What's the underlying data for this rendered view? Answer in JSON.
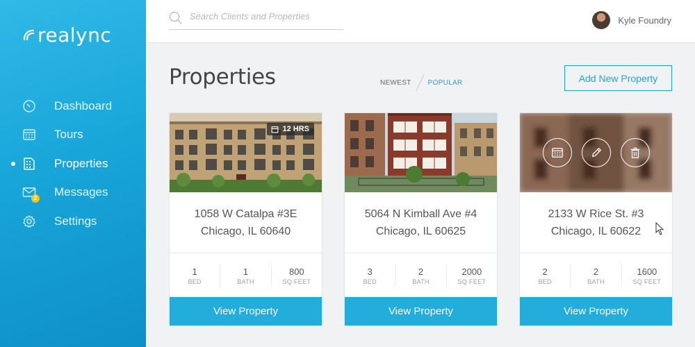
{
  "brand": {
    "name": "realync"
  },
  "sidebar": {
    "items": [
      {
        "label": "Dashboard",
        "icon": "compass-icon",
        "active": false
      },
      {
        "label": "Tours",
        "icon": "calendar-icon",
        "active": false
      },
      {
        "label": "Properties",
        "icon": "properties-grid-icon",
        "active": true
      },
      {
        "label": "Messages",
        "icon": "mail-icon",
        "active": false,
        "badge": "2"
      },
      {
        "label": "Settings",
        "icon": "gear-icon",
        "active": false
      }
    ]
  },
  "header": {
    "search": {
      "placeholder": "Search Clients and Properties",
      "value": ""
    },
    "user": {
      "name": "Kyle Foundry"
    }
  },
  "page": {
    "title": "Properties",
    "sort": {
      "newest": "NEWEST",
      "popular": "POPULAR",
      "selected": "POPULAR"
    },
    "add_button": "Add New Property"
  },
  "properties": [
    {
      "address_line1": "1058 W Catalpa #3E",
      "address_line2": "Chicago, IL 60640",
      "badge": "12 HRS",
      "beds": "1",
      "beds_label": "BED",
      "baths": "1",
      "baths_label": "BATH",
      "sqft": "800",
      "sqft_label": "SQ FEET",
      "button": "View Property"
    },
    {
      "address_line1": "5064 N Kimball Ave #4",
      "address_line2": "Chicago, IL 60625",
      "beds": "3",
      "beds_label": "BED",
      "baths": "2",
      "baths_label": "BATH",
      "sqft": "2000",
      "sqft_label": "SQ FEET",
      "button": "View Property"
    },
    {
      "address_line1": "2133 W Rice St. #3",
      "address_line2": "Chicago, IL 60622",
      "beds": "2",
      "beds_label": "BED",
      "baths": "2",
      "baths_label": "BATH",
      "sqft": "1600",
      "sqft_label": "SQ FEET",
      "button": "View Property",
      "hover_actions": [
        "calendar-icon",
        "edit-pencil-icon",
        "trash-icon"
      ]
    }
  ],
  "colors": {
    "accent": "#23addb",
    "sidebar": "#1ea6d6"
  }
}
